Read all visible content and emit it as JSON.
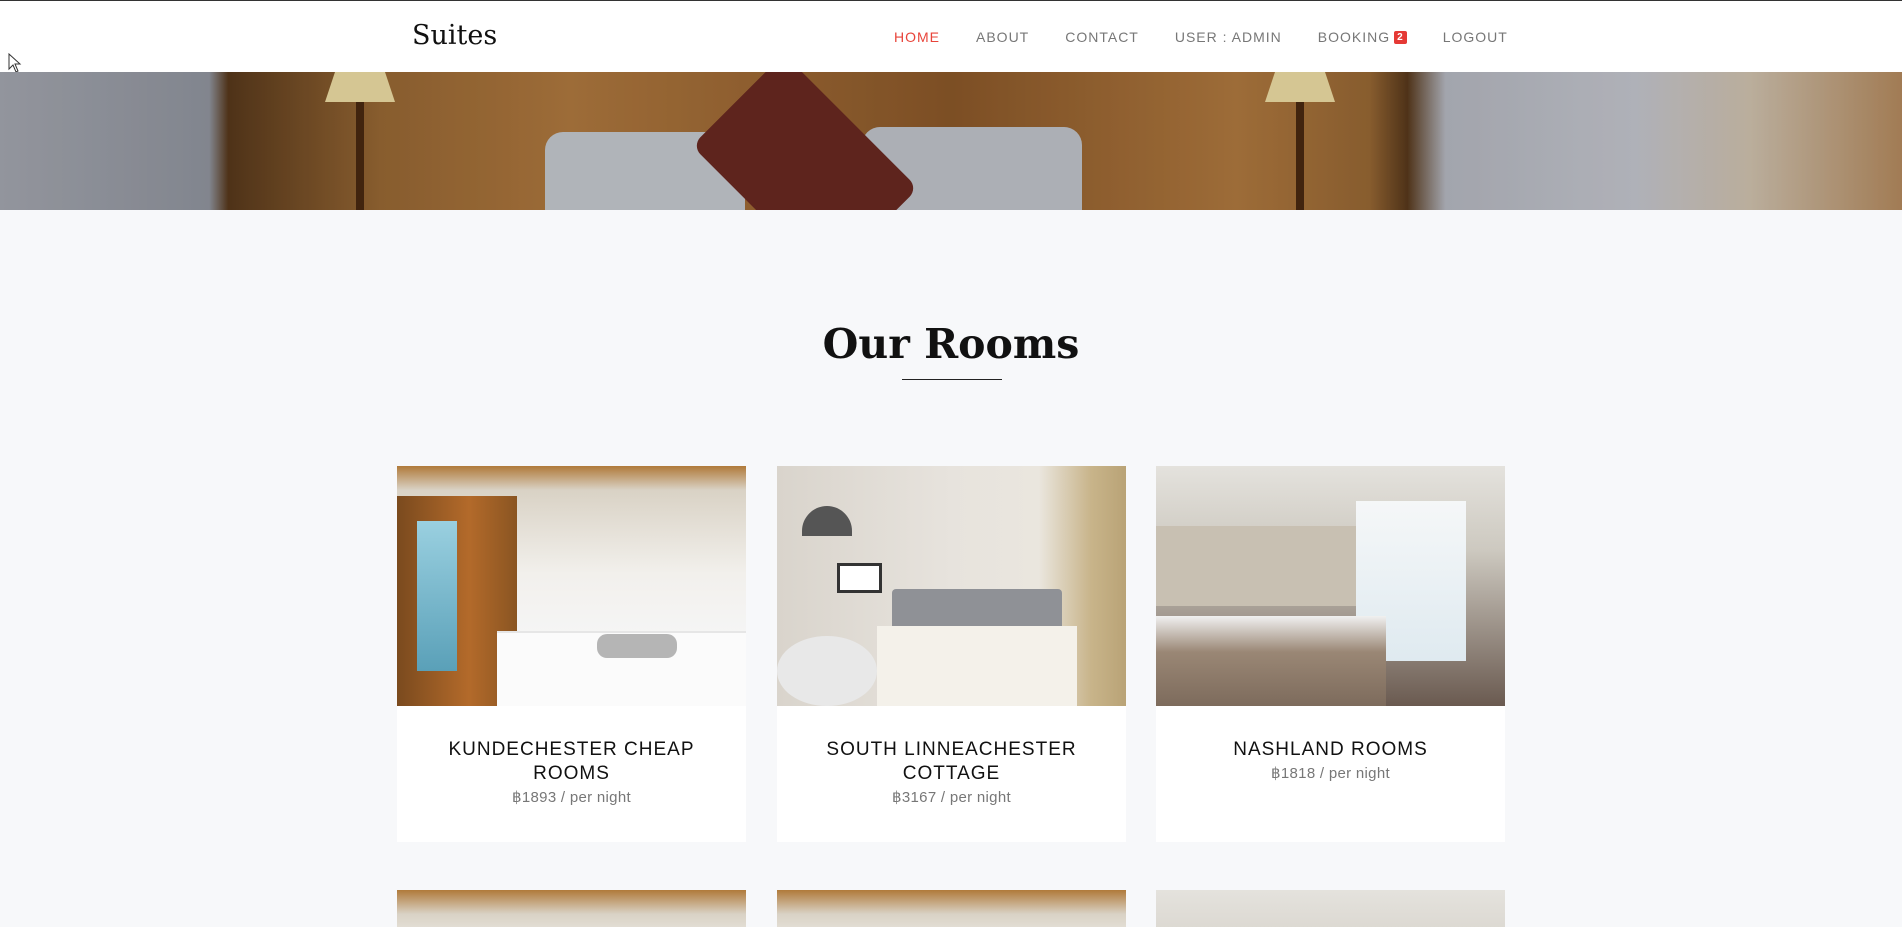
{
  "brand": "Suites",
  "nav": {
    "home": "HOME",
    "about": "ABOUT",
    "contact": "CONTACT",
    "user": "USER : ADMIN",
    "booking": "BOOKING",
    "booking_count": "2",
    "logout": "LOGOUT"
  },
  "section_title": "Our Rooms",
  "rooms": [
    {
      "name": "KUNDECHESTER CHEAP ROOMS",
      "price": "฿1893 / per night"
    },
    {
      "name": "SOUTH LINNEACHESTER COTTAGE",
      "price": "฿3167 / per night"
    },
    {
      "name": "NASHLAND ROOMS",
      "price": "฿1818 / per night"
    }
  ],
  "colors": {
    "accent": "#e8443a",
    "badge": "#e53935",
    "page_bg": "#f7f8fa"
  }
}
